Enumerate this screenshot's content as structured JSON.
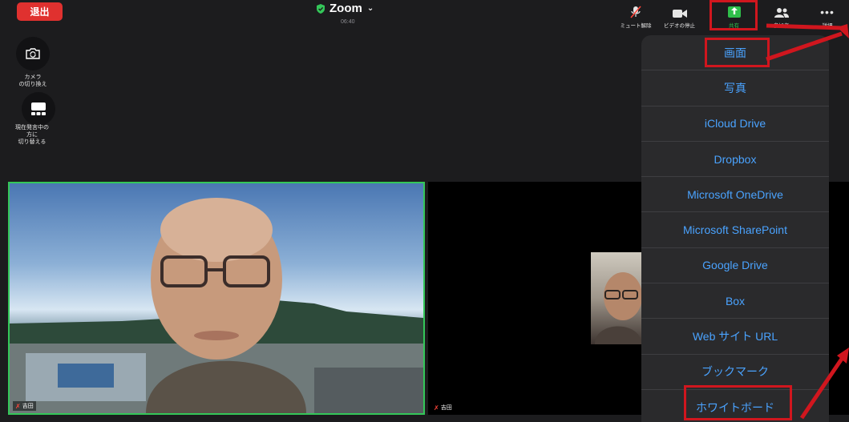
{
  "topbar": {
    "leave_label": "退出",
    "title": "Zoom",
    "timer": "06:40",
    "tools": [
      {
        "label": "ミュート解除",
        "icon": "mic-off-icon"
      },
      {
        "label": "ビデオの停止",
        "icon": "video-camera-icon"
      },
      {
        "label": "共有",
        "icon": "share-screen-icon"
      },
      {
        "label": "参加者",
        "icon": "participants-icon"
      },
      {
        "label": "詳細",
        "icon": "more-icon"
      }
    ]
  },
  "left_panel": {
    "camera_label": "カメラ\nの切り換え",
    "speaker_label": "現在発言中の\n方に\n切り替える"
  },
  "videos": {
    "main_name": "吉田",
    "second_name": "吉田"
  },
  "share_menu": {
    "items": [
      "画面",
      "写真",
      "iCloud Drive",
      "Dropbox",
      "Microsoft OneDrive",
      "Microsoft SharePoint",
      "Google Drive",
      "Box",
      "Web サイト URL",
      "ブックマーク",
      "ホワイトボード"
    ]
  },
  "colors": {
    "accent_green": "#34c759",
    "leave_red": "#e0312f",
    "menu_text_blue": "#4aa3ff",
    "highlight_red": "#d0161e"
  }
}
